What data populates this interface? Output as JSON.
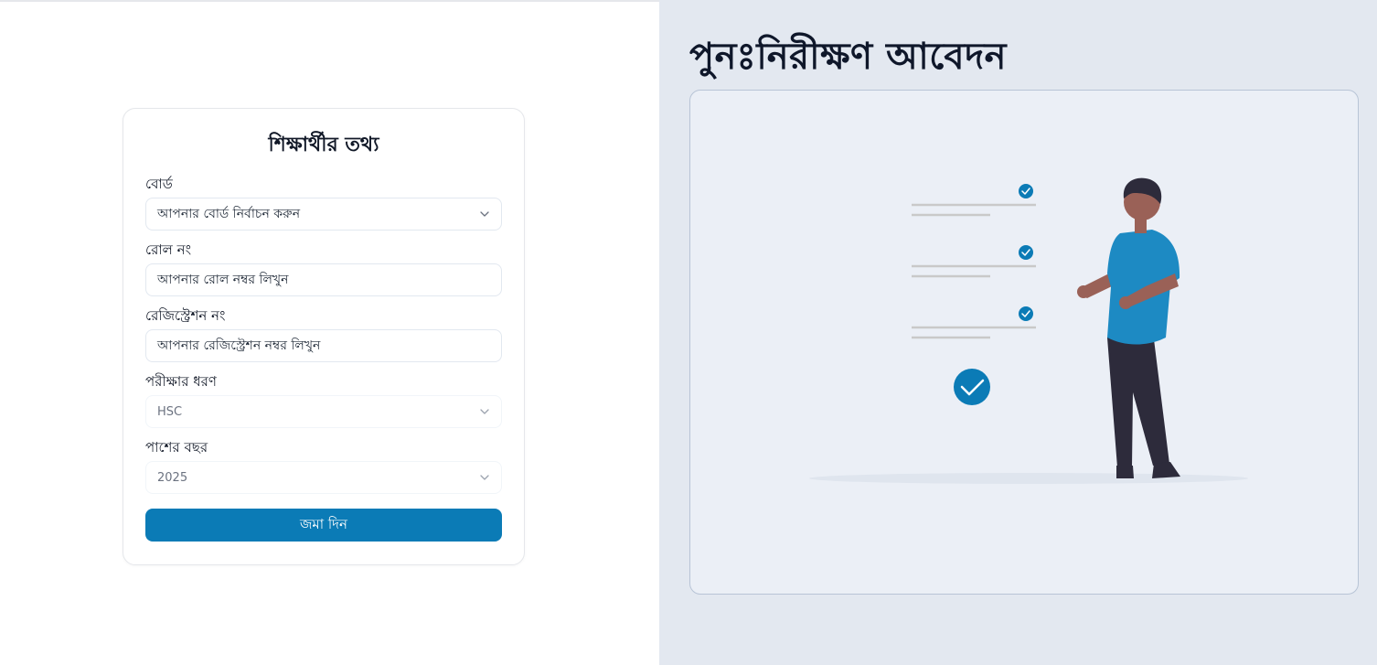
{
  "page_title": "পুনঃনিরীক্ষণ আবেদন",
  "form": {
    "title": "শিক্ষার্থীর তথ্য",
    "board": {
      "label": "বোর্ড",
      "placeholder": "আপনার বোর্ড নির্বাচন করুন"
    },
    "roll": {
      "label": "রোল নং",
      "placeholder": "আপনার রোল নম্বর লিখুন"
    },
    "registration": {
      "label": "রেজিস্ট্রেশন নং",
      "placeholder": "আপনার রেজিস্ট্রেশন নম্বর লিখুন"
    },
    "exam_type": {
      "label": "পরীক্ষার ধরণ",
      "value": "HSC"
    },
    "pass_year": {
      "label": "পাশের বছর",
      "value": "2025"
    },
    "submit_label": "জমা দিন"
  },
  "colors": {
    "accent": "#0b7bb6",
    "shirt": "#1d8ac3",
    "pants": "#2d2b3b",
    "skin": "#9a6157",
    "right_bg": "#e3e8f0"
  },
  "icons": {
    "chevron": "chevron-down-icon",
    "check": "check-circle-icon"
  }
}
